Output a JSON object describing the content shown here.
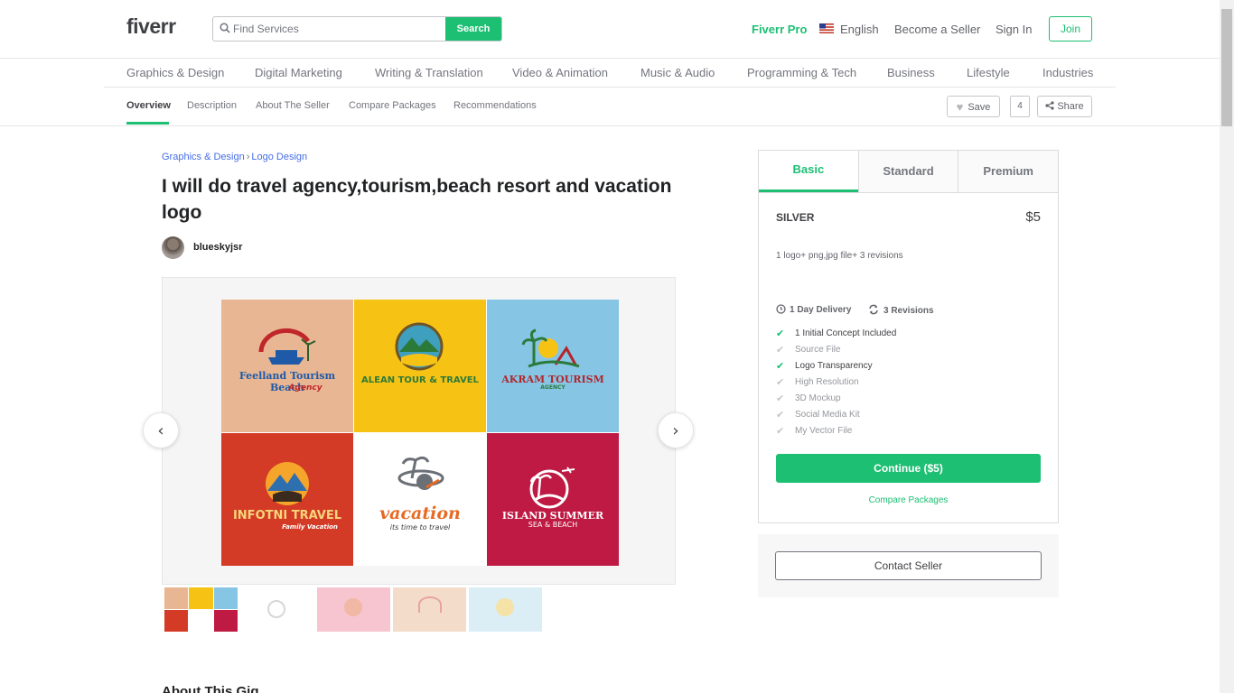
{
  "header": {
    "logo": "fiverr",
    "search_placeholder": "Find Services",
    "search_button": "Search",
    "fiverr_pro": "Fiverr Pro",
    "language": "English",
    "become_seller": "Become a Seller",
    "sign_in": "Sign In",
    "join": "Join"
  },
  "categories": [
    "Graphics & Design",
    "Digital Marketing",
    "Writing & Translation",
    "Video & Animation",
    "Music & Audio",
    "Programming & Tech",
    "Business",
    "Lifestyle",
    "Industries"
  ],
  "subnav": {
    "tabs": [
      "Overview",
      "Description",
      "About The Seller",
      "Compare Packages",
      "Recommendations"
    ],
    "save": "Save",
    "save_count": "4",
    "share": "Share"
  },
  "gig": {
    "breadcrumb": [
      "Graphics & Design",
      "Logo Design"
    ],
    "breadcrumb_sep": "›",
    "title": "I will do travel agency,tourism,beach resort and vacation logo",
    "seller": "blueskyjsr",
    "about_heading": "About This Gig"
  },
  "gallery": {
    "tiles": [
      {
        "text": "Feelland Tourism Beach",
        "sub": "Agency",
        "bg": "#e8b692",
        "fg": "#c0262a"
      },
      {
        "text": "ALEAN TOUR & TRAVEL",
        "sub": "",
        "bg": "#f6c315",
        "fg": "#2c7a3a"
      },
      {
        "text": "AKRAM TOURISM",
        "sub": "AGENCY",
        "bg": "#86c5e4",
        "fg": "#b3262b"
      },
      {
        "text": "INFOTNI TRAVEL",
        "sub": "Family Vacation",
        "bg": "#d43b26",
        "fg": "#f7d57a"
      },
      {
        "text": "vacation",
        "sub": "its time to travel",
        "bg": "#ffffff",
        "fg": "#e76a24"
      },
      {
        "text": "ISLAND SUMMER",
        "sub": "SEA & BEACH",
        "bg": "#be1a43",
        "fg": "#ffffff"
      }
    ],
    "prev_icon": "‹",
    "next_icon": "›",
    "thumb_colors": [
      "#f3c53a",
      "#ffffff",
      "#f6c5d0",
      "#f3dcc9",
      "#dbeef6"
    ]
  },
  "package": {
    "tabs": [
      "Basic",
      "Standard",
      "Premium"
    ],
    "name": "SILVER",
    "price": "$5",
    "description": "1 logo+ png,jpg file+ 3 revisions",
    "delivery": "1 Day Delivery",
    "revisions": "3 Revisions",
    "features": [
      {
        "label": "1 Initial Concept Included",
        "included": true
      },
      {
        "label": "Source File",
        "included": false
      },
      {
        "label": "Logo Transparency",
        "included": true
      },
      {
        "label": "High Resolution",
        "included": false
      },
      {
        "label": "3D Mockup",
        "included": false
      },
      {
        "label": "Social Media Kit",
        "included": false
      },
      {
        "label": "My Vector File",
        "included": false
      }
    ],
    "continue": "Continue ($5)",
    "compare": "Compare Packages",
    "contact": "Contact Seller"
  },
  "colors": {
    "brand_green": "#1dbf73",
    "link_blue": "#446ee7"
  }
}
